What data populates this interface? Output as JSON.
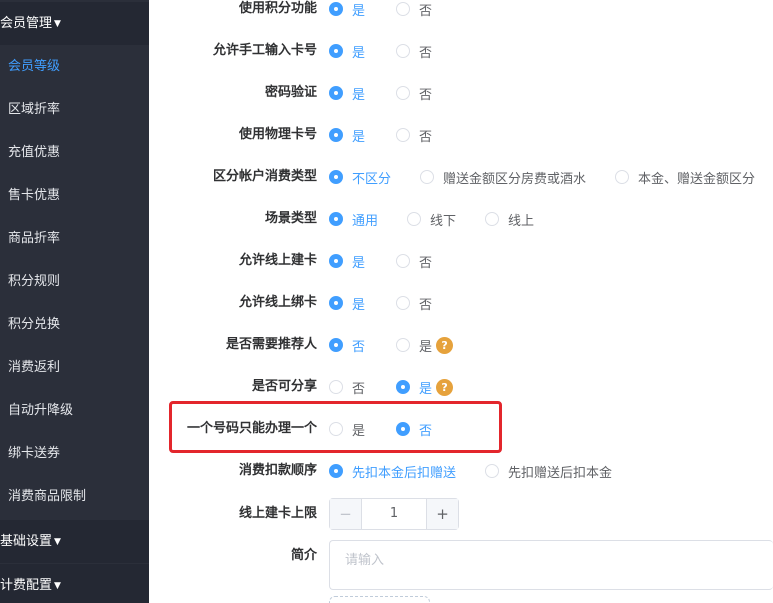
{
  "sidebar": {
    "groups": [
      {
        "label": "会员管理"
      },
      {
        "label": "基础设置"
      },
      {
        "label": "计费配置"
      }
    ],
    "items": [
      {
        "label": "会员等级"
      },
      {
        "label": "区域折率"
      },
      {
        "label": "充值优惠"
      },
      {
        "label": "售卡优惠"
      },
      {
        "label": "商品折率"
      },
      {
        "label": "积分规则"
      },
      {
        "label": "积分兑换"
      },
      {
        "label": "消费返利"
      },
      {
        "label": "自动升降级"
      },
      {
        "label": "绑卡送券"
      },
      {
        "label": "消费商品限制"
      }
    ],
    "active_item": "会员等级"
  },
  "form": {
    "rows": [
      {
        "label": "使用积分功能",
        "options": [
          "是",
          "否"
        ],
        "selected": "是"
      },
      {
        "label": "允许手工输入卡号",
        "options": [
          "是",
          "否"
        ],
        "selected": "是"
      },
      {
        "label": "密码验证",
        "options": [
          "是",
          "否"
        ],
        "selected": "是"
      },
      {
        "label": "使用物理卡号",
        "options": [
          "是",
          "否"
        ],
        "selected": "是"
      },
      {
        "label": "区分帐户消费类型",
        "options": [
          "不区分",
          "赠送金额区分房费或酒水",
          "本金、赠送金额区分"
        ],
        "selected": "不区分"
      },
      {
        "label": "场景类型",
        "options": [
          "通用",
          "线下",
          "线上"
        ],
        "selected": "通用"
      },
      {
        "label": "允许线上建卡",
        "options": [
          "是",
          "否"
        ],
        "selected": "是"
      },
      {
        "label": "允许线上绑卡",
        "options": [
          "是",
          "否"
        ],
        "selected": "是"
      },
      {
        "label": "是否需要推荐人",
        "options": [
          "否",
          "是"
        ],
        "selected": "否"
      },
      {
        "label": "是否可分享",
        "options": [
          "否",
          "是"
        ],
        "selected": "是"
      },
      {
        "label": "一个号码只能办理一个",
        "options": [
          "是",
          "否"
        ],
        "selected": "否"
      },
      {
        "label": "消费扣款顺序",
        "options": [
          "先扣本金后扣赠送",
          "先扣赠送后扣本金"
        ],
        "selected": "先扣本金后扣赠送"
      }
    ],
    "online_card_limit": {
      "label": "线上建卡上限",
      "value": "1",
      "minus": "−",
      "plus": "+"
    },
    "intro": {
      "label": "简介",
      "placeholder": "请输入"
    },
    "help_icon": "question-mark-icon",
    "highlight_color": "#e3262c",
    "accent_color": "#409eff"
  }
}
